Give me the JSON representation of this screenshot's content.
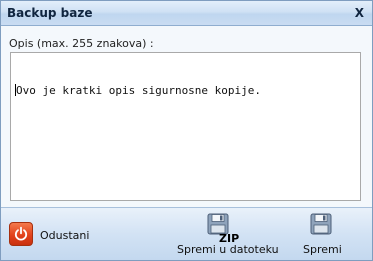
{
  "window": {
    "title": "Backup baze",
    "close_label": "X"
  },
  "form": {
    "description_label": "Opis (max. 255 znakova) :",
    "description_value": "Ovo je kratki opis sigurnosne kopije."
  },
  "footer": {
    "cancel_label": "Odustani",
    "zip_tag": "ZIP",
    "save_to_file_label": "Spremi u datoteku",
    "save_label": "Spremi"
  },
  "icons": {
    "cancel": "power-icon",
    "save_to_file": "floppy-disk-zip-icon",
    "save": "floppy-disk-icon"
  },
  "colors": {
    "accent_red": "#e2431c",
    "title_bar": "#cfe1f4"
  }
}
